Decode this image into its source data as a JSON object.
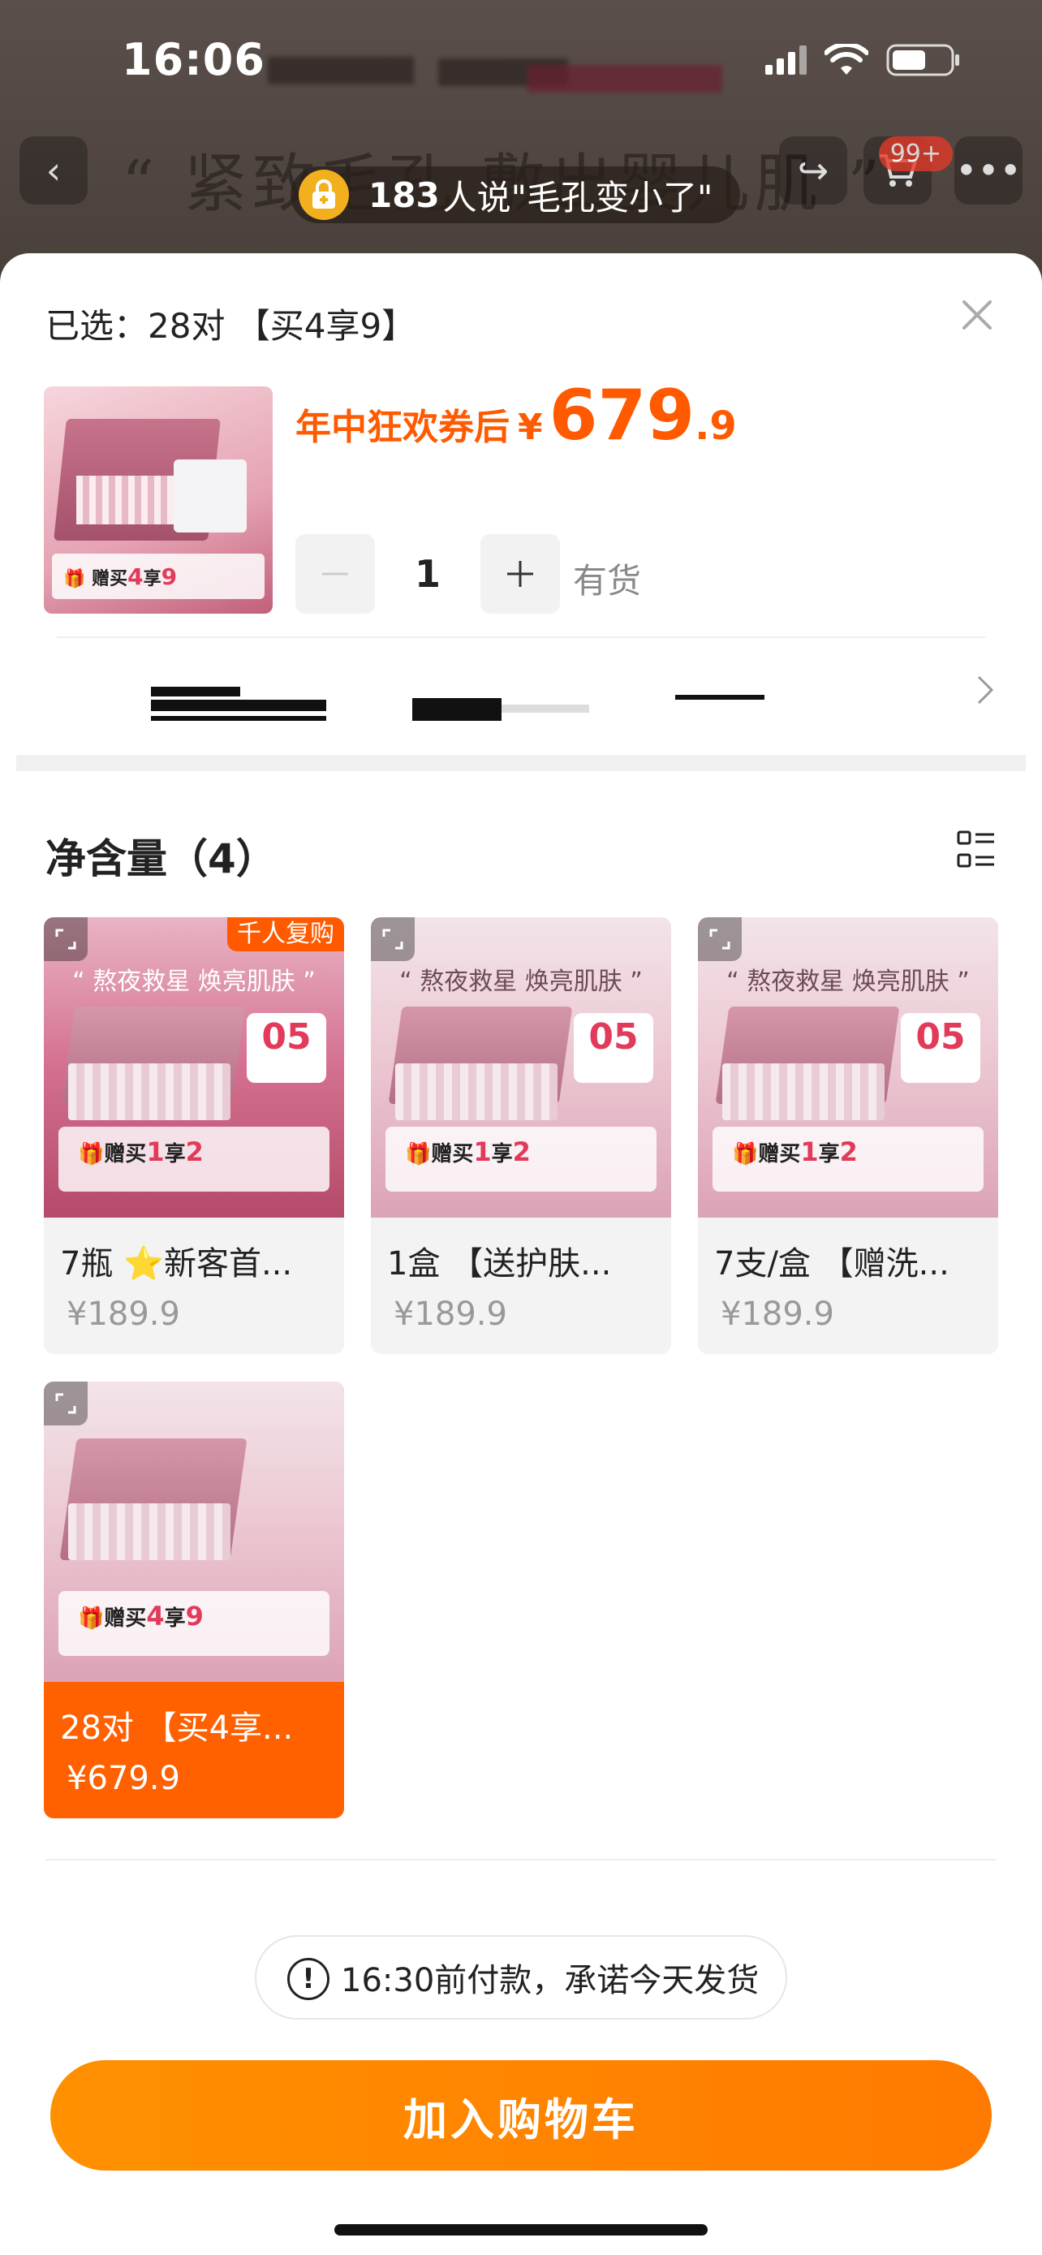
{
  "status_bar": {
    "time": "16:06"
  },
  "background": {
    "headline": "“ 紧致毛孔 敷出婴儿肌 ”",
    "cart_badge": "99+",
    "reviews": {
      "count": "183",
      "text": "人说\"毛孔变小了\""
    }
  },
  "sheet": {
    "selected_label": "已选：28对 【买4享9】",
    "price": {
      "label": "年中狂欢券后",
      "currency": "¥",
      "integer": "679",
      "decimal": ".9"
    },
    "quantity": "1",
    "stock": "有货",
    "section_title": "净含量（4）",
    "variants": [
      {
        "name": "7瓶 ⭐新客首...",
        "price": "¥189.9",
        "slogan": "“ 熬夜救星 焕亮肌肤 ”",
        "badge": "千人复购",
        "coupon": "05",
        "gift_a": "赠买",
        "gift_b": "1",
        "gift_c": "享",
        "gift_d": "2"
      },
      {
        "name": "1盒 【送护肤...",
        "price": "¥189.9",
        "slogan": "“ 熬夜救星 焕亮肌肤 ”",
        "coupon": "05",
        "gift_a": "赠买",
        "gift_b": "1",
        "gift_c": "享",
        "gift_d": "2"
      },
      {
        "name": "7支/盒 【赠洗...",
        "price": "¥189.9",
        "slogan": "“ 熬夜救星 焕亮肌肤 ”",
        "coupon": "05",
        "gift_a": "赠买",
        "gift_b": "1",
        "gift_c": "享",
        "gift_d": "2"
      },
      {
        "name": "28对 【买4享...",
        "price": "¥679.9",
        "gift_a": "赠买",
        "gift_b": "4",
        "gift_c": "享",
        "gift_d": "9"
      }
    ],
    "thumb_gift": {
      "a": "赠买",
      "b": "4",
      "c": "享",
      "d": "9"
    },
    "notice": "16:30前付款，承诺今天发货",
    "cart_button": "加入购物车"
  },
  "colors": {
    "accent": "#ff6000",
    "price": "#ff5a00",
    "button": "#ff8a00"
  },
  "icons": [
    "back-icon",
    "share-icon",
    "cart-icon",
    "more-icon",
    "lock-icon",
    "close-icon",
    "minus-icon",
    "plus-icon",
    "chevron-right-icon",
    "list-view-icon",
    "zoom-icon",
    "gift-icon",
    "alert-icon"
  ]
}
